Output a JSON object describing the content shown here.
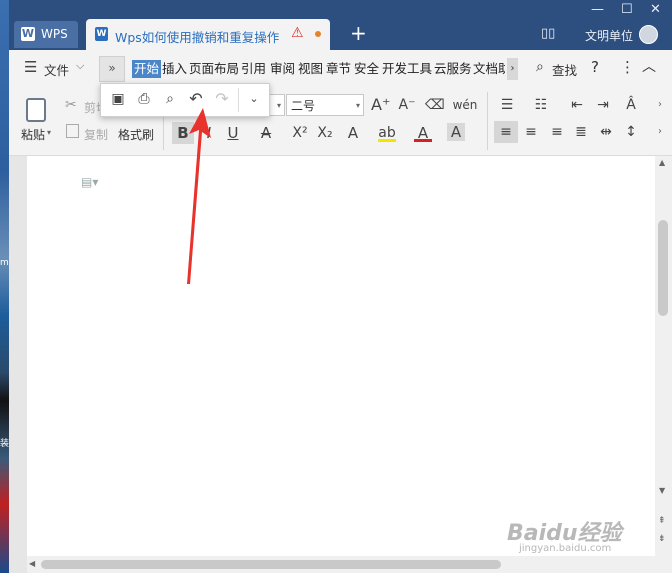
{
  "titlebar": {
    "app_tab": "WPS",
    "doc_tab": "Wps如何使用撤销和重复操作",
    "new_tab": "+",
    "user": "文明单位"
  },
  "menubar": {
    "file": "文件",
    "tabs": [
      "开始",
      "插入",
      "页面布局",
      "引用",
      "审阅",
      "视图",
      "章节",
      "安全",
      "开发工具",
      "云服务",
      "文档助"
    ],
    "active_tab": "开始",
    "search": "查找",
    "help": "?",
    "more": "⋮"
  },
  "ribbon": {
    "paste": "粘贴",
    "cut": "剪切",
    "copy": "复制",
    "format_painter": "格式刷",
    "font_size": "二号"
  },
  "watermark": {
    "brand": "Baidu经验",
    "url": "jingyan.baidu.com"
  },
  "colors": {
    "titlebar": "#2c4f80",
    "accent_tab": "#4a86c8",
    "arrow": "#e8322c",
    "doc_tab_text": "#2a6ebd"
  }
}
